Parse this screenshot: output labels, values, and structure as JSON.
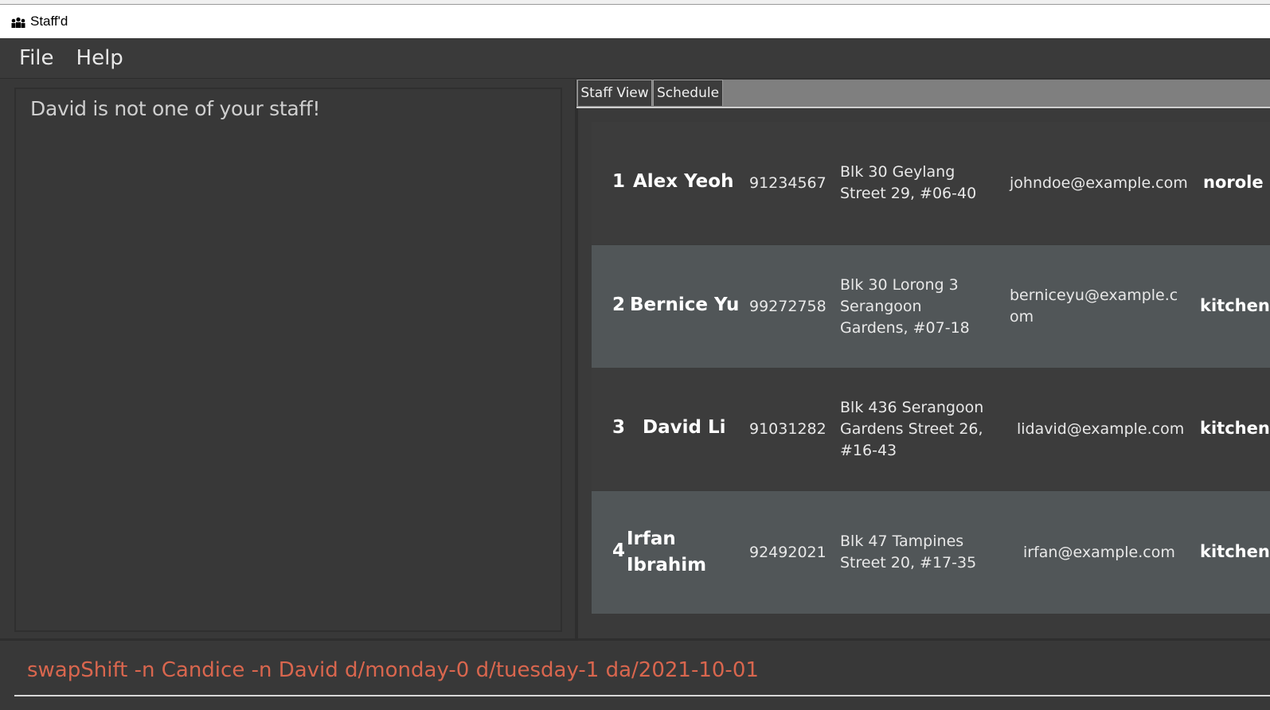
{
  "window": {
    "title": "Staff'd"
  },
  "menu": {
    "file": "File",
    "help": "Help"
  },
  "result": {
    "message": "David is not one of your staff!"
  },
  "tabs": {
    "staff_view": "Staff View",
    "schedule": "Schedule"
  },
  "staff": [
    {
      "index": "1",
      "name": "Alex Yeoh",
      "phone": "91234567",
      "address": "Blk 30 Geylang Street 29, #06-40",
      "email": "johndoe@example.com",
      "role": "norole"
    },
    {
      "index": "2",
      "name": "Bernice Yu",
      "phone": "99272758",
      "address": "Blk 30 Lorong 3 Serangoon Gardens, #07-18",
      "email": "berniceyu@example.com",
      "role": "kitchen"
    },
    {
      "index": "3",
      "name": "David Li",
      "phone": "91031282",
      "address": "Blk 436 Serangoon Gardens Street 26, #16-43",
      "email": "lidavid@example.com",
      "role": "kitchen"
    },
    {
      "index": "4",
      "name": "Irfan Ibrahim",
      "phone": "92492021",
      "address": "Blk 47 Tampines Street 20, #17-35",
      "email": "irfan@example.com",
      "role": "kitchen"
    }
  ],
  "command": {
    "value": "swapShift -n Candice -n David d/monday-0 d/tuesday-1 da/2021-10-01"
  }
}
